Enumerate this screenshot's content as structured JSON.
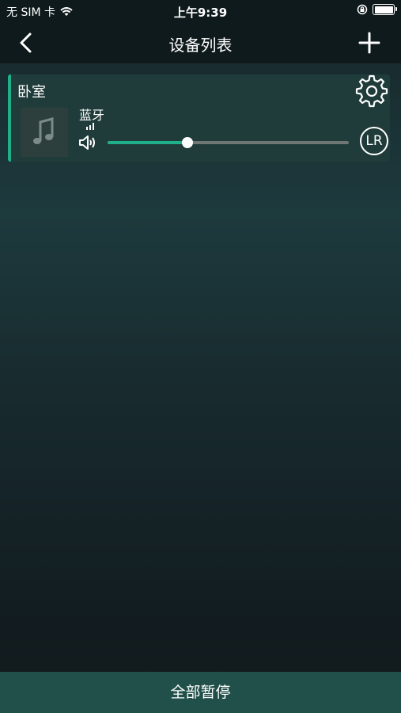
{
  "status_bar": {
    "carrier": "无 SIM 卡",
    "time": "上午9:39"
  },
  "nav": {
    "title": "设备列表"
  },
  "devices": [
    {
      "name": "卧室",
      "source": "蓝牙",
      "volume": 0.33,
      "channel_label": "LR"
    }
  ],
  "bottom": {
    "pause_all_label": "全部暂停"
  },
  "colors": {
    "accent": "#1fb08a",
    "card_bg": "#1f3c3a",
    "bar_bg": "#0f1a1d",
    "bottom_bar": "#21504a"
  },
  "icons": [
    "wifi-icon",
    "orientation-lock-icon",
    "battery-icon",
    "back-chevron-icon",
    "plus-icon",
    "gear-icon",
    "music-note-icon",
    "signal-icon",
    "speaker-icon"
  ]
}
